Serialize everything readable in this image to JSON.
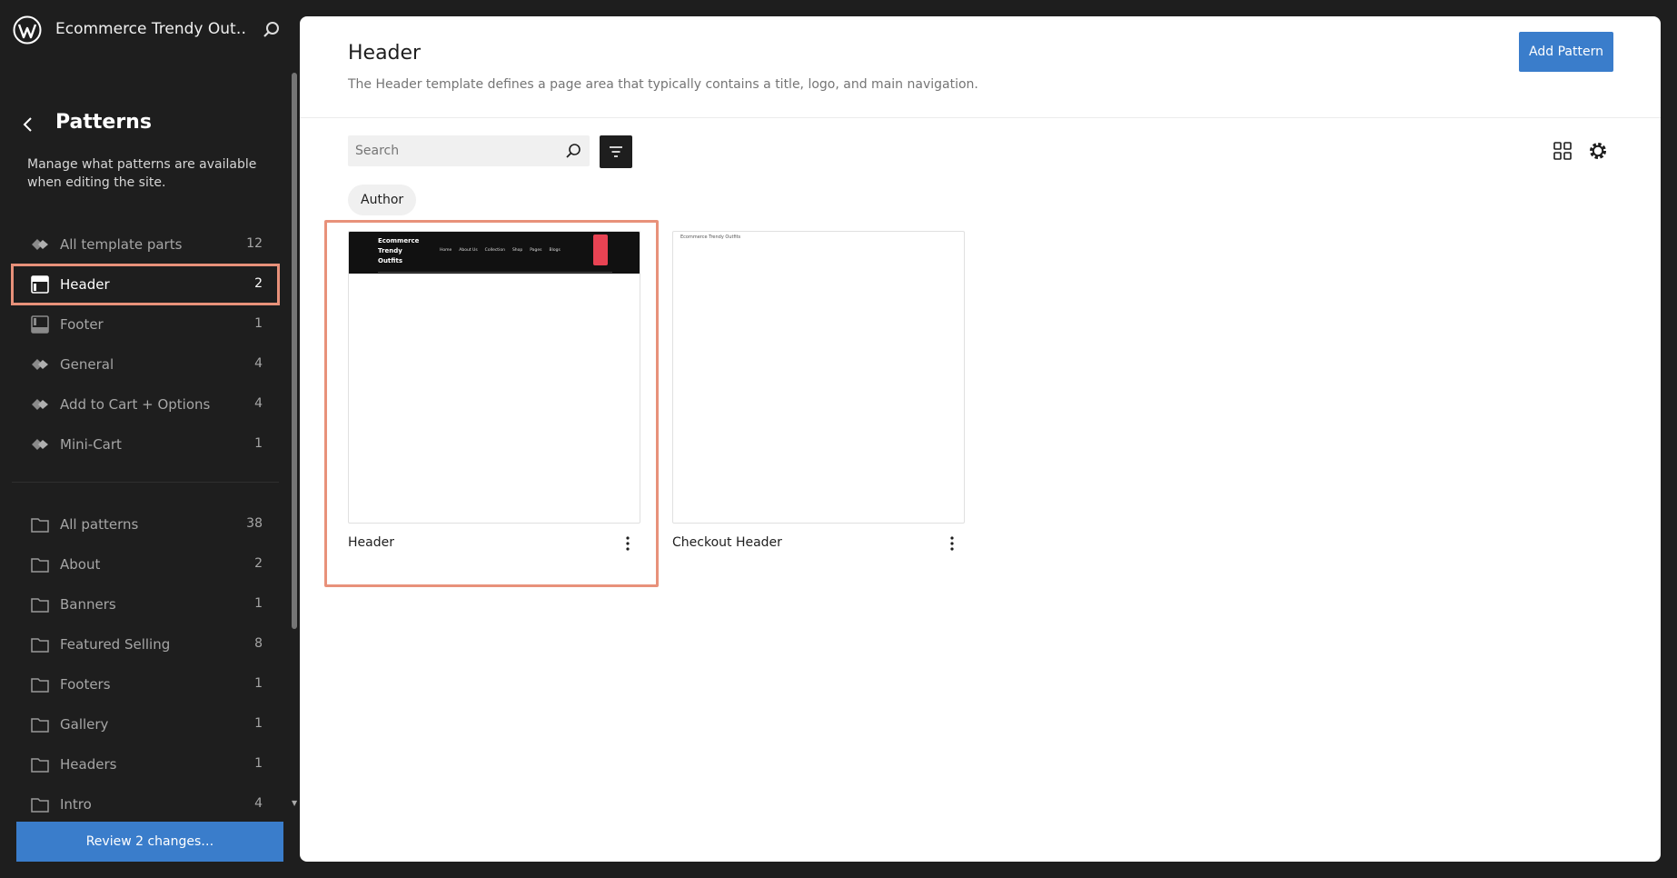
{
  "sidebar": {
    "site_title": "Ecommerce Trendy Out…",
    "title": "Patterns",
    "description": "Manage what patterns are available when editing the site.",
    "template_parts": [
      {
        "label": "All template parts",
        "count": "12",
        "icon": "diamond-icon"
      },
      {
        "label": "Header",
        "count": "2",
        "icon": "header-icon",
        "active": true
      },
      {
        "label": "Footer",
        "count": "1",
        "icon": "footer-icon"
      },
      {
        "label": "General",
        "count": "4",
        "icon": "diamond-icon"
      },
      {
        "label": "Add to Cart + Options",
        "count": "4",
        "icon": "diamond-icon"
      },
      {
        "label": "Mini-Cart",
        "count": "1",
        "icon": "diamond-icon"
      }
    ],
    "categories": [
      {
        "label": "All patterns",
        "count": "38"
      },
      {
        "label": "About",
        "count": "2"
      },
      {
        "label": "Banners",
        "count": "1"
      },
      {
        "label": "Featured Selling",
        "count": "8"
      },
      {
        "label": "Footers",
        "count": "1"
      },
      {
        "label": "Gallery",
        "count": "1"
      },
      {
        "label": "Headers",
        "count": "1"
      },
      {
        "label": "Intro",
        "count": "4"
      }
    ],
    "review_label": "Review 2 changes…"
  },
  "main": {
    "title": "Header",
    "description": "The Header template defines a page area that typically contains a title, logo, and main navigation.",
    "add_pattern_label": "Add Pattern",
    "search_placeholder": "Search",
    "chip_label": "Author",
    "cards": [
      {
        "title": "Header",
        "preview": {
          "brand": "Ecommerce Trendy Outfits",
          "nav": [
            "Home",
            "About Us",
            "Collection",
            "Shop",
            "Pages",
            "Blogs"
          ]
        }
      },
      {
        "title": "Checkout Header",
        "preview_text": "Ecommerce Trendy Outfits"
      }
    ]
  },
  "colors": {
    "accent": "#3a7dcb",
    "highlight": "#e8917a",
    "sidebar_bg": "#1e1e1e"
  }
}
